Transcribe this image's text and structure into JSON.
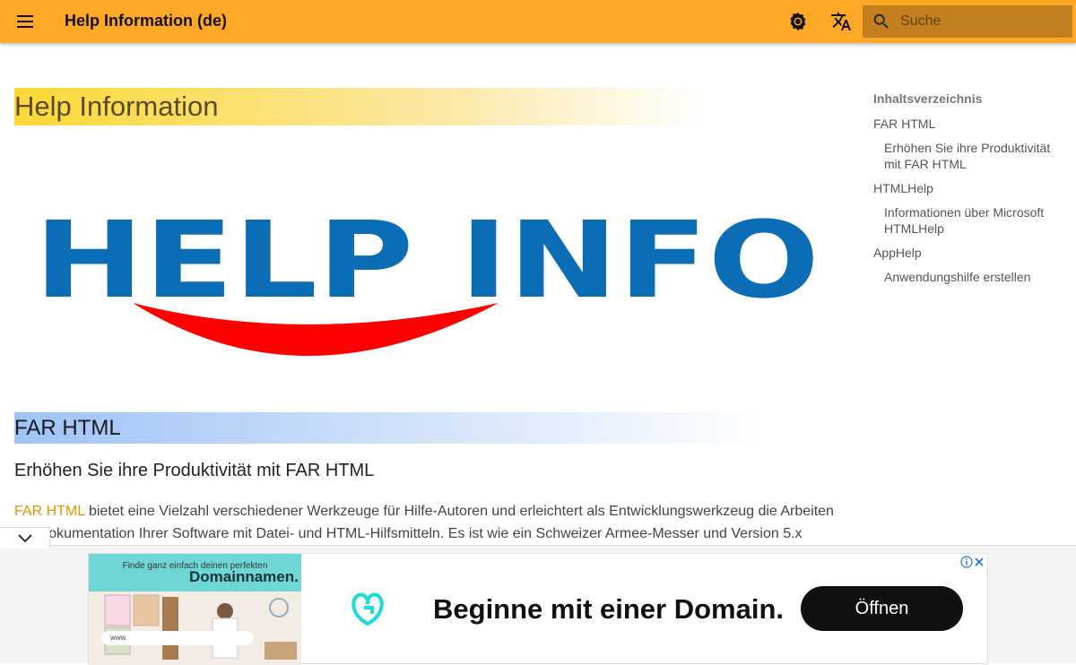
{
  "header": {
    "title": "Help Information (de)",
    "search_placeholder": "Suche",
    "accent_color": "#ffa726"
  },
  "main": {
    "heading": "Help Information",
    "logo_text": "HELP INFO",
    "section_heading": "FAR HTML",
    "subheading": "Erhöhen Sie ihre Produktivität mit FAR HTML",
    "paragraph_link": "FAR HTML",
    "paragraph_rest": " bietet eine Vielzahl verschiedener Werkzeuge für Hilfe-Autoren und erleichtert als Entwicklungswerkzeug die Arbeiten zur Dokumentation Ihrer Software mit Datei- und HTML-Hilfsmitteln. Es ist wie ein Schweizer Armee-Messer und Version 5.x"
  },
  "toc": {
    "title": "Inhaltsverzeichnis",
    "items": [
      {
        "label": "FAR HTML",
        "level": 1
      },
      {
        "label": "Erhöhen Sie ihre Produktivität mit FAR HTML",
        "level": 2
      },
      {
        "label": "HTMLHelp",
        "level": 1
      },
      {
        "label": "Informationen über Microsoft HTMLHelp",
        "level": 2
      },
      {
        "label": "AppHelp",
        "level": 1
      },
      {
        "label": "Anwendungshilfe erstellen",
        "level": 2
      }
    ]
  },
  "ad": {
    "image_small_text": "Finde ganz einfach deinen perfekten",
    "image_big_text": "Domainnamen.",
    "image_url_text": "www.",
    "headline": "Beginne mit einer Domain.",
    "cta_label": "Öffnen",
    "info_icon": "info-icon",
    "close_icon": "close-icon"
  },
  "icons": {
    "menu": "menu-icon",
    "theme": "brightness-icon",
    "language": "translate-icon",
    "search": "search-icon",
    "collapse": "chevron-down-icon"
  }
}
